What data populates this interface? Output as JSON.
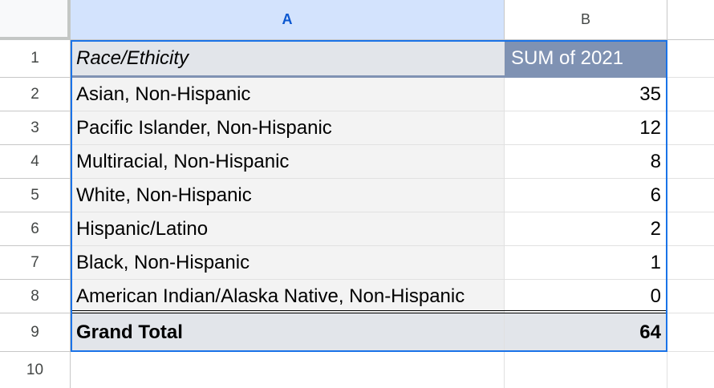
{
  "columns": [
    {
      "label": "A",
      "selected": true
    },
    {
      "label": "B",
      "selected": false
    }
  ],
  "row_numbers": [
    "1",
    "2",
    "3",
    "4",
    "5",
    "6",
    "7",
    "8",
    "9",
    "10"
  ],
  "pivot": {
    "header": {
      "label": "Race/Ethicity",
      "value": "SUM of 2021"
    },
    "rows": [
      {
        "label": "Asian, Non-Hispanic",
        "value": "35"
      },
      {
        "label": "Pacific Islander, Non-Hispanic",
        "value": "12"
      },
      {
        "label": "Multiracial, Non-Hispanic",
        "value": "8"
      },
      {
        "label": "White, Non-Hispanic",
        "value": "6"
      },
      {
        "label": "Hispanic/Latino",
        "value": "2"
      },
      {
        "label": "Black, Non-Hispanic",
        "value": "1"
      },
      {
        "label": "American Indian/Alaska Native, Non-Hispanic",
        "value": "0"
      }
    ],
    "total": {
      "label": "Grand Total",
      "value": "64"
    }
  },
  "colors": {
    "selected_column_header": "#d3e3fd",
    "pivot_header_value_bg": "#7f92b3",
    "pivot_total_bg": "#e2e5ea",
    "selection_border": "#1a73e8"
  }
}
